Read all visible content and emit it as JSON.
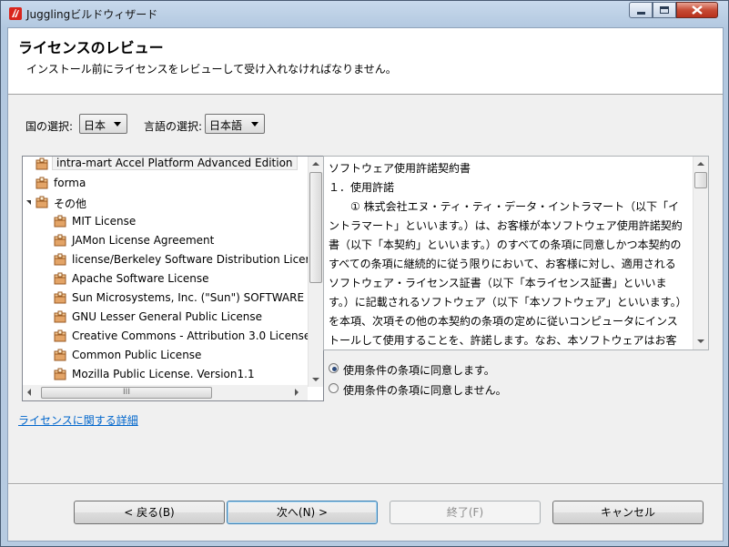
{
  "window": {
    "title": "JugglingビルドウィザードH",
    "title_text": "Jugglingビルドウィザード"
  },
  "header": {
    "title": "ライセンスのレビュー",
    "subtitle": "インストール前にライセンスをレビューして受け入れなければなりません。"
  },
  "country": {
    "label": "国の選択:",
    "value": "日本"
  },
  "language": {
    "label": "言語の選択:",
    "value": "日本語"
  },
  "tree": {
    "items": [
      {
        "label": "intra-mart Accel Platform Advanced Edition",
        "level": 0,
        "selected": true
      },
      {
        "label": "forma",
        "level": 0
      },
      {
        "label": "その他",
        "level": 0,
        "expanded": true
      },
      {
        "label": "MIT License",
        "level": 1
      },
      {
        "label": "JAMon License Agreement",
        "level": 1
      },
      {
        "label": "license/Berkeley Software Distribution Licer",
        "level": 1
      },
      {
        "label": "Apache Software License",
        "level": 1
      },
      {
        "label": "Sun Microsystems, Inc. (\"Sun\") SOFTWARE",
        "level": 1
      },
      {
        "label": "GNU Lesser General Public License",
        "level": 1
      },
      {
        "label": "Creative Commons - Attribution 3.0 License",
        "level": 1
      },
      {
        "label": "Common Public License",
        "level": 1
      },
      {
        "label": "Mozilla Public License. Version1.1",
        "level": 1
      }
    ],
    "hscroll_label": "III"
  },
  "license_text": "ソフトウェア使用許諾契約書\n１．使用許諾\n　　① 株式会社エヌ・ティ・ティ・データ・イントラマート（以下「イントラマート」といいます。）は、お客様が本ソフトウェア使用許諾契約書（以下「本契約」といいます。）のすべての条項に同意しかつ本契約のすべての条項に継続的に従う限りにおいて、お客様に対し、適用されるソフトウェア・ライセンス証書（以下「本ライセンス証書」といいます。）に記載されるソフトウェア（以下「本ソフトウェア」といいます。）を本項、次項その他の本契約の条項の定めに従いコンピュータにインストールして使用することを、許諾します。なお、本ソフトウェアはお客様に対して非独占的に使用許諾されるものであり、販売されるも",
  "radios": {
    "accept": "使用条件の条項に同意します。",
    "decline": "使用条件の条項に同意しません。",
    "selected": "accept"
  },
  "details_link": "ライセンスに関する詳細",
  "buttons": {
    "back": "< 戻る(B)",
    "next": "次へ(N) >",
    "finish": "終了(F)",
    "cancel": "キャンセル"
  },
  "colors": {
    "link": "#0066cc",
    "title_bar": "#b7cbe1",
    "radio_dot": "#2d4b7c"
  }
}
